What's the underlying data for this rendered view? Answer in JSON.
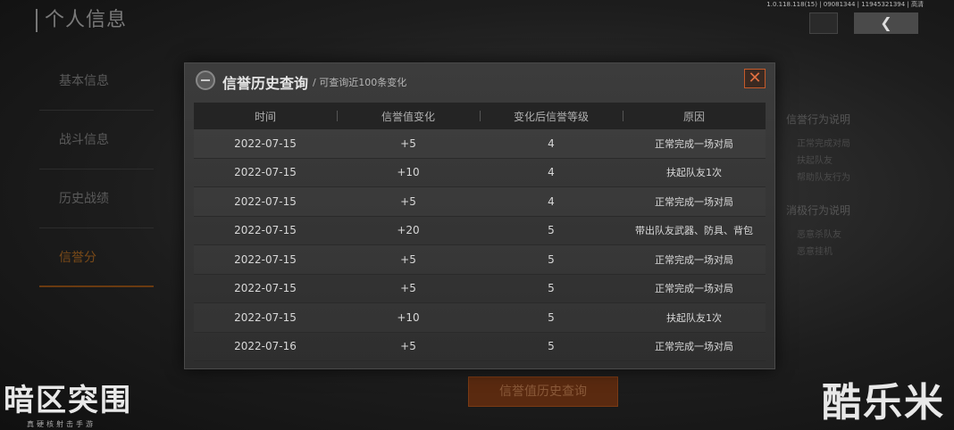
{
  "page": {
    "title": "个人信息",
    "version": "1.0.118.118(15) | 09081344 | 11945321394 | 高清",
    "back_label": "❮"
  },
  "side_nav": [
    {
      "label": "基本信息"
    },
    {
      "label": "战斗信息"
    },
    {
      "label": "历史战绩"
    },
    {
      "label": "信誉分"
    }
  ],
  "right_panel": {
    "positive_title": "信誉行为说明",
    "positive_lines": [
      "正常完成对局",
      "扶起队友",
      "帮助队友行为"
    ],
    "negative_title": "消极行为说明",
    "negative_lines": [
      "恶意杀队友",
      "恶意挂机"
    ]
  },
  "bottom_button": "信誉值历史查询",
  "logo": {
    "main": "暗区突围",
    "sub": "真硬核射击手游"
  },
  "watermark": "酷乐米",
  "modal": {
    "title": "信誉历史查询",
    "subtitle": "/ 可查询近100条变化",
    "close_label": "✕",
    "columns": [
      "时间",
      "信誉值变化",
      "变化后信誉等级",
      "原因"
    ],
    "rows": [
      {
        "date": "2022-07-15",
        "change": "+5",
        "level": "4",
        "reason": "正常完成一场对局"
      },
      {
        "date": "2022-07-15",
        "change": "+10",
        "level": "4",
        "reason": "扶起队友1次"
      },
      {
        "date": "2022-07-15",
        "change": "+5",
        "level": "4",
        "reason": "正常完成一场对局"
      },
      {
        "date": "2022-07-15",
        "change": "+20",
        "level": "5",
        "reason": "带出队友武器、防具、背包"
      },
      {
        "date": "2022-07-15",
        "change": "+5",
        "level": "5",
        "reason": "正常完成一场对局"
      },
      {
        "date": "2022-07-15",
        "change": "+5",
        "level": "5",
        "reason": "正常完成一场对局"
      },
      {
        "date": "2022-07-15",
        "change": "+10",
        "level": "5",
        "reason": "扶起队友1次"
      },
      {
        "date": "2022-07-16",
        "change": "+5",
        "level": "5",
        "reason": "正常完成一场对局"
      }
    ]
  },
  "colors": {
    "accent_orange": "#c55a2a",
    "active_nav": "#7a4a18"
  }
}
